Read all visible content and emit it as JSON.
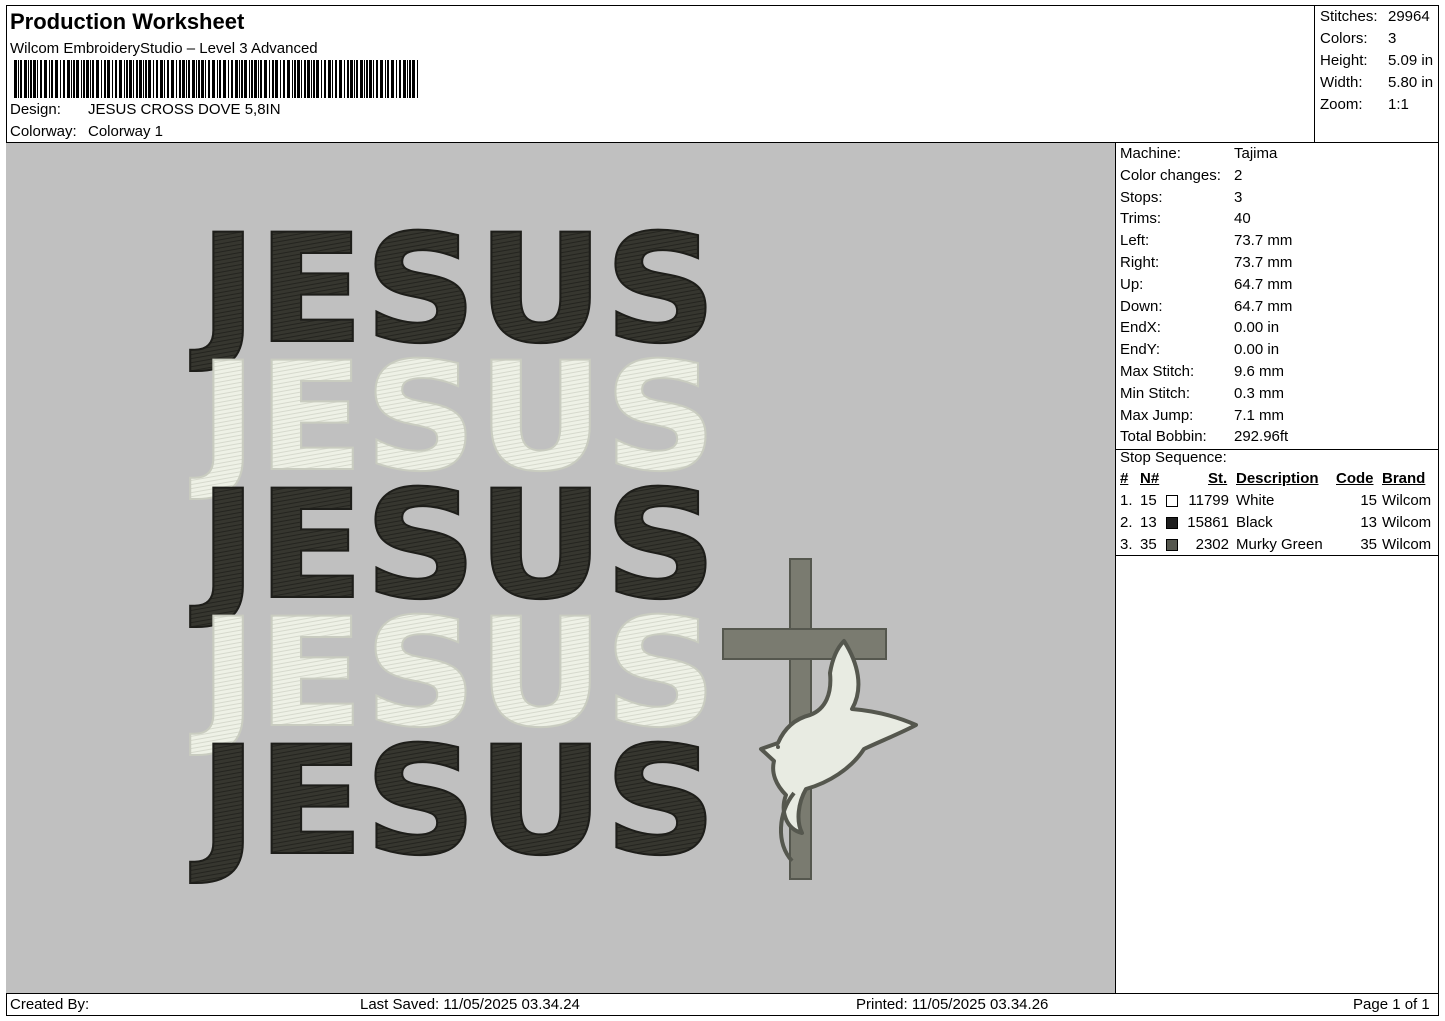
{
  "header": {
    "title": "Production Worksheet",
    "software": "Wilcom EmbroideryStudio – Level 3 Advanced",
    "design_label": "Design:",
    "design_value": "JESUS CROSS DOVE 5,8IN",
    "colorway_label": "Colorway:",
    "colorway_value": "Colorway 1"
  },
  "summary": {
    "stitches_label": "Stitches:",
    "stitches_value": "29964",
    "colors_label": "Colors:",
    "colors_value": "3",
    "height_label": "Height:",
    "height_value": "5.09 in",
    "width_label": "Width:",
    "width_value": "5.80 in",
    "zoom_label": "Zoom:",
    "zoom_value": "1:1"
  },
  "machine": [
    {
      "label": "Machine:",
      "value": "Tajima"
    },
    {
      "label": "Color changes:",
      "value": "2"
    },
    {
      "label": "Stops:",
      "value": "3"
    },
    {
      "label": "Trims:",
      "value": "40"
    },
    {
      "label": "Left:",
      "value": "73.7 mm"
    },
    {
      "label": "Right:",
      "value": "73.7 mm"
    },
    {
      "label": "Up:",
      "value": "64.7 mm"
    },
    {
      "label": "Down:",
      "value": "64.7 mm"
    },
    {
      "label": "EndX:",
      "value": "0.00 in"
    },
    {
      "label": "EndY:",
      "value": "0.00 in"
    },
    {
      "label": "Max Stitch:",
      "value": "9.6 mm"
    },
    {
      "label": "Min Stitch:",
      "value": "0.3 mm"
    },
    {
      "label": "Max Jump:",
      "value": "7.1 mm"
    },
    {
      "label": "Total Bobbin:",
      "value": "292.96ft"
    }
  ],
  "stop_sequence": {
    "title": "Stop Sequence:",
    "headers": {
      "num": "#",
      "n": "N#",
      "st": "St.",
      "description": "Description",
      "code": "Code",
      "brand": "Brand"
    },
    "rows": [
      {
        "num": "1.",
        "n": "15",
        "color": "#ffffff",
        "st": "11799",
        "description": "White",
        "code": "15",
        "brand": "Wilcom"
      },
      {
        "num": "2.",
        "n": "13",
        "color": "#1e1e1e",
        "st": "15861",
        "description": "Black",
        "code": "13",
        "brand": "Wilcom"
      },
      {
        "num": "3.",
        "n": "35",
        "color": "#55574e",
        "st": "2302",
        "description": "Murky Green",
        "code": "35",
        "brand": "Wilcom"
      }
    ]
  },
  "design": {
    "words": [
      "JESUS",
      "JESUS",
      "JESUS",
      "JESUS",
      "JESUS"
    ],
    "word_colors": [
      "#36362f",
      "#eef1e6",
      "#36362f",
      "#eef1e6",
      "#36362f"
    ],
    "cross_color": "#7a7b70",
    "dove_color": "#e8ebe2",
    "dove_outline": "#55574e",
    "background": "#c0c0c0"
  },
  "footer": {
    "created_by": "Created By:",
    "last_saved": "Last Saved: 11/05/2025 03.34.24",
    "printed": "Printed: 11/05/2025 03.34.26",
    "page": "Page 1 of 1"
  }
}
